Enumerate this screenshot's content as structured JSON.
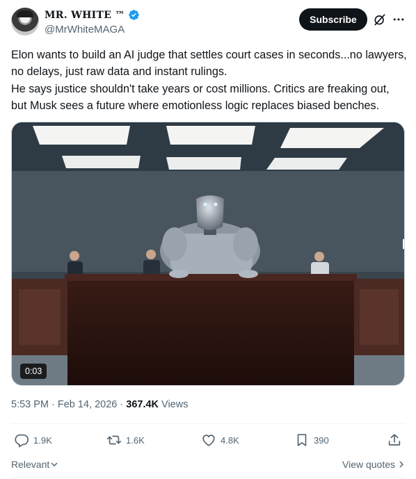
{
  "author": {
    "display_name": "MR. WHITE ™",
    "handle": "@MrWhiteMAGA"
  },
  "header": {
    "subscribe_label": "Subscribe"
  },
  "tweet": {
    "paragraphs": [
      "Elon wants to build an AI judge that settles court cases in seconds...no lawyers, no delays, just raw data and instant rulings.",
      "He says justice shouldn't take years or cost millions. Critics are freaking out, but Musk sees a future where emotionless logic replaces biased benches."
    ]
  },
  "media": {
    "duration": "0:03"
  },
  "meta": {
    "time": "5:53 PM",
    "separator": " · ",
    "date": "Feb 14, 2026",
    "views_count": "367.4K",
    "views_label": " Views"
  },
  "actions": {
    "replies": "1.9K",
    "reposts": "1.6K",
    "likes": "4.8K",
    "bookmarks": "390"
  },
  "footer": {
    "sort_label": "Relevant",
    "view_quotes_label": "View quotes"
  },
  "colors": {
    "verified_blue": "#1d9bf0",
    "text_secondary": "#536471",
    "button_dark": "#0f1419"
  },
  "icons": [
    "verified-badge-icon",
    "grok-icon",
    "more-icon",
    "reply-icon",
    "repost-icon",
    "like-icon",
    "bookmark-icon",
    "share-icon",
    "chevron-down-icon",
    "chevron-right-icon"
  ]
}
